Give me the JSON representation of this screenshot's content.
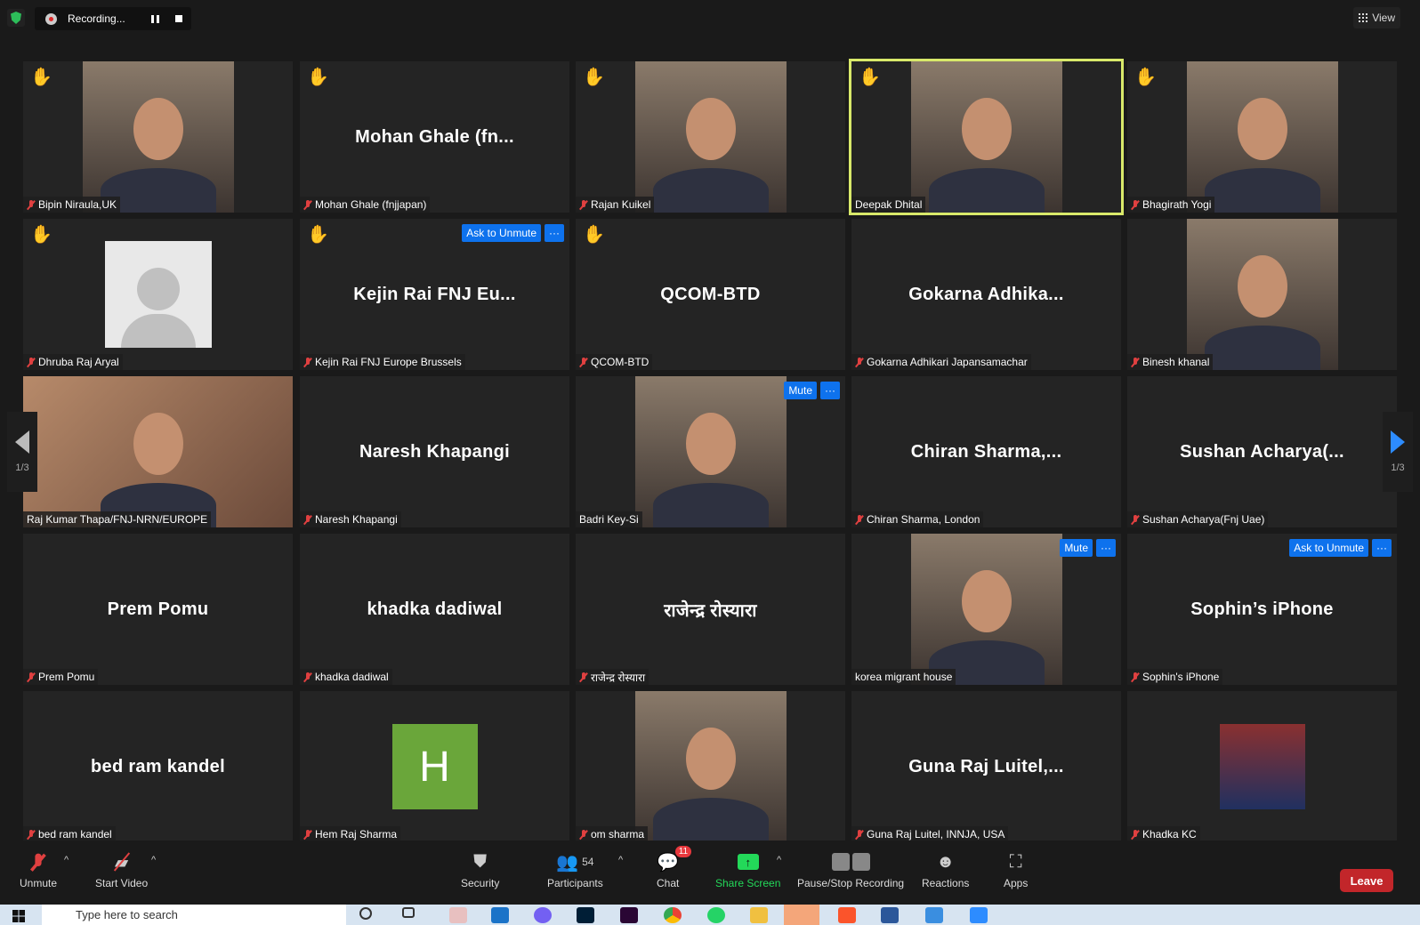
{
  "top": {
    "recording_label": "Recording...",
    "view_label": "View"
  },
  "pager": {
    "left": "1/3",
    "right": "1/3"
  },
  "tiles": [
    {
      "name": "Bipin Niraula,UK",
      "hand": true,
      "muted": true,
      "kind": "photo"
    },
    {
      "name": "Mohan Ghale (fnjjapan)",
      "display": "Mohan  Ghale  (fn...",
      "hand": true,
      "muted": true,
      "kind": "text"
    },
    {
      "name": "Rajan Kuikel",
      "hand": true,
      "muted": true,
      "kind": "photo"
    },
    {
      "name": "Deepak Dhital",
      "hand": true,
      "muted": false,
      "kind": "photo",
      "active": true
    },
    {
      "name": "Bhagirath Yogi",
      "hand": true,
      "muted": true,
      "kind": "photo"
    },
    {
      "name": "Dhruba Raj Aryal",
      "hand": true,
      "muted": true,
      "kind": "avatar"
    },
    {
      "name": "Kejin Rai FNJ Europe Brussels",
      "display": "Kejin Rai FNJ Eu...",
      "hand": true,
      "muted": true,
      "kind": "text",
      "buttons": [
        "Ask to Unmute",
        "···"
      ]
    },
    {
      "name": "QCOM-BTD",
      "display": "QCOM-BTD",
      "hand": true,
      "muted": true,
      "kind": "text"
    },
    {
      "name": "Gokarna Adhikari Japansamachar",
      "display": "Gokarna  Adhika...",
      "muted": true,
      "kind": "text"
    },
    {
      "name": "Binesh khanal",
      "muted": true,
      "kind": "photo"
    },
    {
      "name": "Raj Kumar Thapa/FNJ-NRN/EUROPE",
      "muted": false,
      "kind": "wide"
    },
    {
      "name": "Naresh Khapangi",
      "display": "Naresh Khapangi",
      "muted": true,
      "kind": "text"
    },
    {
      "name": "Badri Key-Si",
      "muted": false,
      "kind": "photo",
      "buttons": [
        "Mute",
        "···"
      ]
    },
    {
      "name": "Chiran Sharma, London",
      "display": "Chiran  Sharma,...",
      "muted": true,
      "kind": "text"
    },
    {
      "name": "Sushan Acharya(Fnj Uae)",
      "display": "Sushan  Acharya(...",
      "muted": true,
      "kind": "text"
    },
    {
      "name": "Prem Pomu",
      "display": "Prem Pomu",
      "muted": true,
      "kind": "text"
    },
    {
      "name": "khadka dadiwal",
      "display": "khadka dadiwal",
      "muted": true,
      "kind": "text"
    },
    {
      "name": "राजेन्द्र रोस्यारा",
      "display": "राजेन्द्र रोस्यारा",
      "muted": true,
      "kind": "text"
    },
    {
      "name": "korea migrant house",
      "muted": false,
      "kind": "photo",
      "buttons": [
        "Mute",
        "···"
      ]
    },
    {
      "name": "Sophin's iPhone",
      "display": "Sophin’s iPhone",
      "muted": true,
      "kind": "text",
      "buttons": [
        "Ask to Unmute",
        "···"
      ]
    },
    {
      "name": "bed ram kandel",
      "display": "bed ram kandel",
      "muted": true,
      "kind": "text"
    },
    {
      "name": "Hem Raj Sharma",
      "letter": "H",
      "muted": true,
      "kind": "letter"
    },
    {
      "name": "om sharma",
      "muted": true,
      "kind": "photo"
    },
    {
      "name": "Guna Raj Luitel, INNJA, USA",
      "display": "Guna  Raj  Luitel,...",
      "muted": true,
      "kind": "text"
    },
    {
      "name": "Khadka KC",
      "muted": true,
      "kind": "small"
    }
  ],
  "toolbar": {
    "unmute": "Unmute",
    "start_video": "Start Video",
    "security": "Security",
    "participants": "Participants",
    "participants_count": "54",
    "chat": "Chat",
    "chat_badge": "11",
    "share_screen": "Share Screen",
    "pause_stop": "Pause/Stop Recording",
    "reactions": "Reactions",
    "apps": "Apps",
    "leave": "Leave"
  },
  "taskbar": {
    "search_placeholder": "Type here to search"
  },
  "colors": {
    "accent": "#0e72ed",
    "active_speaker": "#d9e96a",
    "leave": "#c2262a",
    "share": "#23d959"
  }
}
